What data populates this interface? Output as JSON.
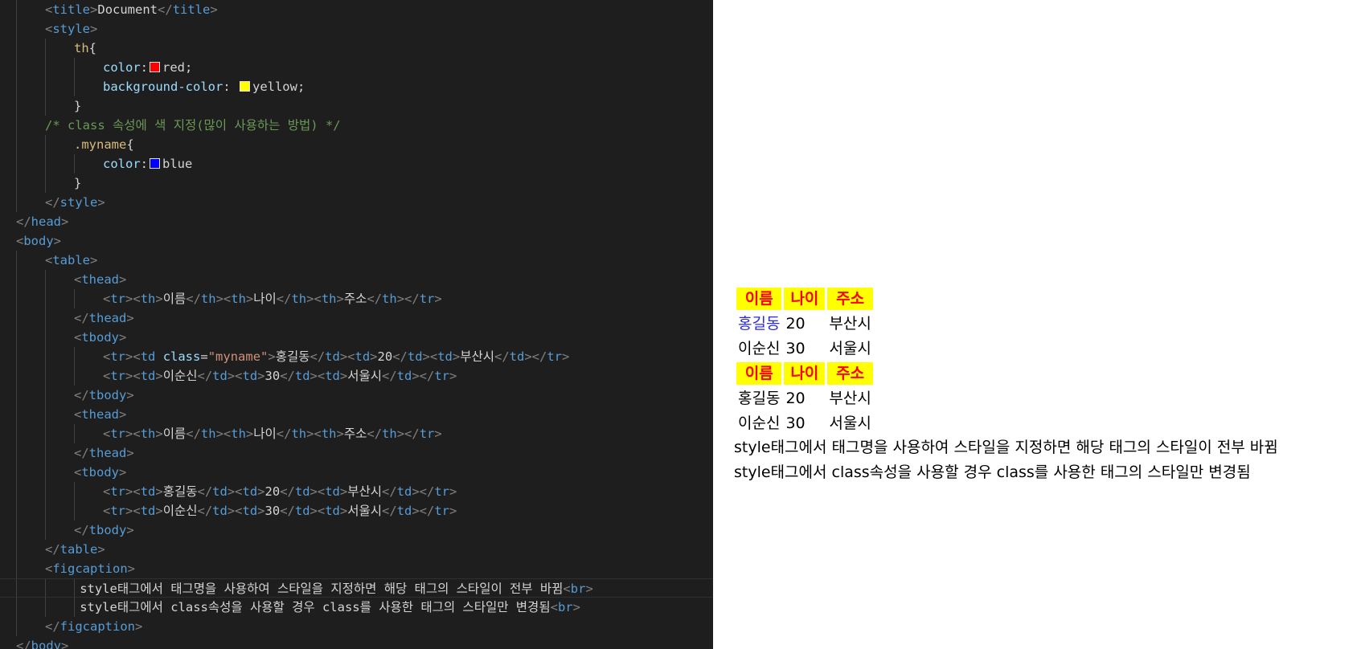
{
  "editor": {
    "colors": {
      "background": "#1e1e1e",
      "tag": "#569cd6",
      "property": "#9cdcfe",
      "string": "#ce9178",
      "comment": "#6a9955",
      "selector": "#d7ba7d"
    },
    "lines": [
      {
        "indent": 1,
        "tokens": [
          [
            "punct",
            "<"
          ],
          [
            "tag",
            "title"
          ],
          [
            "punct",
            ">"
          ],
          [
            "text",
            "Document"
          ],
          [
            "punct",
            "</"
          ],
          [
            "tag",
            "title"
          ],
          [
            "punct",
            ">"
          ]
        ]
      },
      {
        "indent": 1,
        "tokens": [
          [
            "punct",
            "<"
          ],
          [
            "tag",
            "style"
          ],
          [
            "punct",
            ">"
          ]
        ]
      },
      {
        "indent": 2,
        "tokens": [
          [
            "sel",
            "th"
          ],
          [
            "brace",
            "{"
          ]
        ]
      },
      {
        "indent": 3,
        "tokens": [
          [
            "prop",
            "color"
          ],
          [
            "brace",
            ":"
          ],
          [
            "swatch",
            "#ff0000"
          ],
          [
            "val",
            "red;"
          ]
        ]
      },
      {
        "indent": 3,
        "tokens": [
          [
            "prop",
            "background-color"
          ],
          [
            "brace",
            ": "
          ],
          [
            "swatch",
            "#ffff00"
          ],
          [
            "val",
            "yellow;"
          ]
        ]
      },
      {
        "indent": 2,
        "tokens": [
          [
            "brace",
            "}"
          ]
        ]
      },
      {
        "indent": 1,
        "tokens": [
          [
            "cmt",
            "/* class 속성에 색 지정(많이 사용하는 방법) */"
          ]
        ]
      },
      {
        "indent": 2,
        "tokens": [
          [
            "sel",
            ".myname"
          ],
          [
            "brace",
            "{"
          ]
        ]
      },
      {
        "indent": 3,
        "tokens": [
          [
            "prop",
            "color"
          ],
          [
            "brace",
            ":"
          ],
          [
            "swatch",
            "#0000ff"
          ],
          [
            "val",
            "blue"
          ]
        ]
      },
      {
        "indent": 2,
        "tokens": [
          [
            "brace",
            "}"
          ]
        ]
      },
      {
        "indent": 1,
        "tokens": [
          [
            "punct",
            "</"
          ],
          [
            "tag",
            "style"
          ],
          [
            "punct",
            ">"
          ]
        ]
      },
      {
        "indent": 0,
        "tokens": [
          [
            "punct",
            "</"
          ],
          [
            "tag",
            "head"
          ],
          [
            "punct",
            ">"
          ]
        ]
      },
      {
        "indent": 0,
        "tokens": [
          [
            "punct",
            "<"
          ],
          [
            "tag",
            "body"
          ],
          [
            "punct",
            ">"
          ]
        ]
      },
      {
        "indent": 1,
        "tokens": [
          [
            "punct",
            "<"
          ],
          [
            "tag",
            "table"
          ],
          [
            "punct",
            ">"
          ]
        ]
      },
      {
        "indent": 2,
        "tokens": [
          [
            "punct",
            "<"
          ],
          [
            "tag",
            "thead"
          ],
          [
            "punct",
            ">"
          ]
        ]
      },
      {
        "indent": 3,
        "tokens": [
          [
            "punct",
            "<"
          ],
          [
            "tag",
            "tr"
          ],
          [
            "punct",
            "><"
          ],
          [
            "tag",
            "th"
          ],
          [
            "punct",
            ">"
          ],
          [
            "text",
            "이름"
          ],
          [
            "punct",
            "</"
          ],
          [
            "tag",
            "th"
          ],
          [
            "punct",
            "><"
          ],
          [
            "tag",
            "th"
          ],
          [
            "punct",
            ">"
          ],
          [
            "text",
            "나이"
          ],
          [
            "punct",
            "</"
          ],
          [
            "tag",
            "th"
          ],
          [
            "punct",
            "><"
          ],
          [
            "tag",
            "th"
          ],
          [
            "punct",
            ">"
          ],
          [
            "text",
            "주소"
          ],
          [
            "punct",
            "</"
          ],
          [
            "tag",
            "th"
          ],
          [
            "punct",
            "></"
          ],
          [
            "tag",
            "tr"
          ],
          [
            "punct",
            ">"
          ]
        ]
      },
      {
        "indent": 2,
        "tokens": [
          [
            "punct",
            "</"
          ],
          [
            "tag",
            "thead"
          ],
          [
            "punct",
            ">"
          ]
        ]
      },
      {
        "indent": 2,
        "tokens": [
          [
            "punct",
            "<"
          ],
          [
            "tag",
            "tbody"
          ],
          [
            "punct",
            ">"
          ]
        ]
      },
      {
        "indent": 3,
        "tokens": [
          [
            "punct",
            "<"
          ],
          [
            "tag",
            "tr"
          ],
          [
            "punct",
            "><"
          ],
          [
            "tag",
            "td "
          ],
          [
            "attr",
            "class"
          ],
          [
            "text",
            "="
          ],
          [
            "str",
            "\"myname\""
          ],
          [
            "punct",
            ">"
          ],
          [
            "text",
            "홍길동"
          ],
          [
            "punct",
            "</"
          ],
          [
            "tag",
            "td"
          ],
          [
            "punct",
            "><"
          ],
          [
            "tag",
            "td"
          ],
          [
            "punct",
            ">"
          ],
          [
            "text",
            "20"
          ],
          [
            "punct",
            "</"
          ],
          [
            "tag",
            "td"
          ],
          [
            "punct",
            "><"
          ],
          [
            "tag",
            "td"
          ],
          [
            "punct",
            ">"
          ],
          [
            "text",
            "부산시"
          ],
          [
            "punct",
            "</"
          ],
          [
            "tag",
            "td"
          ],
          [
            "punct",
            "></"
          ],
          [
            "tag",
            "tr"
          ],
          [
            "punct",
            ">"
          ]
        ]
      },
      {
        "indent": 3,
        "tokens": [
          [
            "punct",
            "<"
          ],
          [
            "tag",
            "tr"
          ],
          [
            "punct",
            "><"
          ],
          [
            "tag",
            "td"
          ],
          [
            "punct",
            ">"
          ],
          [
            "text",
            "이순신"
          ],
          [
            "punct",
            "</"
          ],
          [
            "tag",
            "td"
          ],
          [
            "punct",
            "><"
          ],
          [
            "tag",
            "td"
          ],
          [
            "punct",
            ">"
          ],
          [
            "text",
            "30"
          ],
          [
            "punct",
            "</"
          ],
          [
            "tag",
            "td"
          ],
          [
            "punct",
            "><"
          ],
          [
            "tag",
            "td"
          ],
          [
            "punct",
            ">"
          ],
          [
            "text",
            "서울시"
          ],
          [
            "punct",
            "</"
          ],
          [
            "tag",
            "td"
          ],
          [
            "punct",
            "></"
          ],
          [
            "tag",
            "tr"
          ],
          [
            "punct",
            ">"
          ]
        ]
      },
      {
        "indent": 2,
        "tokens": [
          [
            "punct",
            "</"
          ],
          [
            "tag",
            "tbody"
          ],
          [
            "punct",
            ">"
          ]
        ]
      },
      {
        "indent": 2,
        "tokens": [
          [
            "punct",
            "<"
          ],
          [
            "tag",
            "thead"
          ],
          [
            "punct",
            ">"
          ]
        ]
      },
      {
        "indent": 3,
        "tokens": [
          [
            "punct",
            "<"
          ],
          [
            "tag",
            "tr"
          ],
          [
            "punct",
            "><"
          ],
          [
            "tag",
            "th"
          ],
          [
            "punct",
            ">"
          ],
          [
            "text",
            "이름"
          ],
          [
            "punct",
            "</"
          ],
          [
            "tag",
            "th"
          ],
          [
            "punct",
            "><"
          ],
          [
            "tag",
            "th"
          ],
          [
            "punct",
            ">"
          ],
          [
            "text",
            "나이"
          ],
          [
            "punct",
            "</"
          ],
          [
            "tag",
            "th"
          ],
          [
            "punct",
            "><"
          ],
          [
            "tag",
            "th"
          ],
          [
            "punct",
            ">"
          ],
          [
            "text",
            "주소"
          ],
          [
            "punct",
            "</"
          ],
          [
            "tag",
            "th"
          ],
          [
            "punct",
            "></"
          ],
          [
            "tag",
            "tr"
          ],
          [
            "punct",
            ">"
          ]
        ]
      },
      {
        "indent": 2,
        "tokens": [
          [
            "punct",
            "</"
          ],
          [
            "tag",
            "thead"
          ],
          [
            "punct",
            ">"
          ]
        ]
      },
      {
        "indent": 2,
        "tokens": [
          [
            "punct",
            "<"
          ],
          [
            "tag",
            "tbody"
          ],
          [
            "punct",
            ">"
          ]
        ]
      },
      {
        "indent": 3,
        "tokens": [
          [
            "punct",
            "<"
          ],
          [
            "tag",
            "tr"
          ],
          [
            "punct",
            "><"
          ],
          [
            "tag",
            "td"
          ],
          [
            "punct",
            ">"
          ],
          [
            "text",
            "홍길동"
          ],
          [
            "punct",
            "</"
          ],
          [
            "tag",
            "td"
          ],
          [
            "punct",
            "><"
          ],
          [
            "tag",
            "td"
          ],
          [
            "punct",
            ">"
          ],
          [
            "text",
            "20"
          ],
          [
            "punct",
            "</"
          ],
          [
            "tag",
            "td"
          ],
          [
            "punct",
            "><"
          ],
          [
            "tag",
            "td"
          ],
          [
            "punct",
            ">"
          ],
          [
            "text",
            "부산시"
          ],
          [
            "punct",
            "</"
          ],
          [
            "tag",
            "td"
          ],
          [
            "punct",
            "></"
          ],
          [
            "tag",
            "tr"
          ],
          [
            "punct",
            ">"
          ]
        ]
      },
      {
        "indent": 3,
        "tokens": [
          [
            "punct",
            "<"
          ],
          [
            "tag",
            "tr"
          ],
          [
            "punct",
            "><"
          ],
          [
            "tag",
            "td"
          ],
          [
            "punct",
            ">"
          ],
          [
            "text",
            "이순신"
          ],
          [
            "punct",
            "</"
          ],
          [
            "tag",
            "td"
          ],
          [
            "punct",
            "><"
          ],
          [
            "tag",
            "td"
          ],
          [
            "punct",
            ">"
          ],
          [
            "text",
            "30"
          ],
          [
            "punct",
            "</"
          ],
          [
            "tag",
            "td"
          ],
          [
            "punct",
            "><"
          ],
          [
            "tag",
            "td"
          ],
          [
            "punct",
            ">"
          ],
          [
            "text",
            "서울시"
          ],
          [
            "punct",
            "</"
          ],
          [
            "tag",
            "td"
          ],
          [
            "punct",
            "></"
          ],
          [
            "tag",
            "tr"
          ],
          [
            "punct",
            ">"
          ]
        ]
      },
      {
        "indent": 2,
        "tokens": [
          [
            "punct",
            "</"
          ],
          [
            "tag",
            "tbody"
          ],
          [
            "punct",
            ">"
          ]
        ]
      },
      {
        "indent": 1,
        "tokens": [
          [
            "punct",
            "</"
          ],
          [
            "tag",
            "table"
          ],
          [
            "punct",
            ">"
          ]
        ]
      },
      {
        "indent": 1,
        "tokens": [
          [
            "punct",
            "<"
          ],
          [
            "tag",
            "figcaption"
          ],
          [
            "punct",
            ">"
          ]
        ]
      },
      {
        "indent": 2.2,
        "current": true,
        "tokens": [
          [
            "text",
            "style태그에서 태그명을 사용하여 스타일을 지정하면 해당 태그의 스타일이 전부 바뀜"
          ],
          [
            "punct",
            "<"
          ],
          [
            "tag",
            "br"
          ],
          [
            "punct",
            ">"
          ]
        ]
      },
      {
        "indent": 2.2,
        "tokens": [
          [
            "text",
            "style태그에서 class속성을 사용할 경우 class를 사용한 태그의 스타일만 변경됨"
          ],
          [
            "punct",
            "<"
          ],
          [
            "tag",
            "br"
          ],
          [
            "punct",
            ">"
          ]
        ]
      },
      {
        "indent": 1,
        "tokens": [
          [
            "punct",
            "</"
          ],
          [
            "tag",
            "figcaption"
          ],
          [
            "punct",
            ">"
          ]
        ]
      },
      {
        "indent": 0,
        "tokens": [
          [
            "punct",
            "</"
          ],
          [
            "tag",
            "body"
          ],
          [
            "punct",
            ">"
          ]
        ]
      }
    ]
  },
  "preview": {
    "colors": {
      "header_bg": "#ffff00",
      "header_text": "#ff0000",
      "myname_text": "#2a2ae0"
    },
    "table1": {
      "headers": [
        "이름",
        "나이",
        "주소"
      ],
      "rows": [
        [
          "홍길동",
          "20",
          "부산시"
        ],
        [
          "이순신",
          "30",
          "서울시"
        ]
      ]
    },
    "table2": {
      "headers": [
        "이름",
        "나이",
        "주소"
      ],
      "rows": [
        [
          "홍길동",
          "20",
          "부산시"
        ],
        [
          "이순신",
          "30",
          "서울시"
        ]
      ]
    },
    "caption": {
      "line1": "style태그에서 태그명을 사용하여 스타일을 지정하면 해당 태그의 스타일이 전부 바뀜",
      "line2": "style태그에서 class속성을 사용할 경우 class를 사용한 태그의 스타일만 변경됨"
    }
  }
}
